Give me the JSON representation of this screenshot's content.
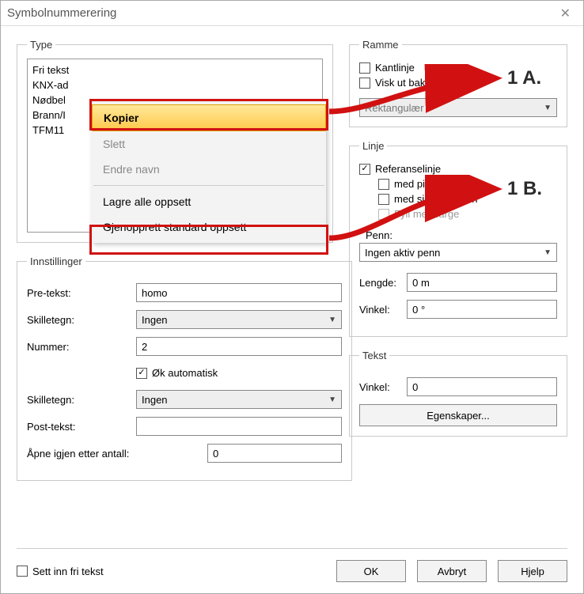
{
  "window": {
    "title": "Symbolnummerering"
  },
  "type": {
    "legend": "Type",
    "items": [
      "Fri tekst",
      "KNX-ad",
      "Nødbel",
      "Brann/I",
      "TFM11"
    ]
  },
  "context_menu": {
    "copy": "Kopier",
    "delete": "Slett",
    "rename": "Endre navn",
    "save_all": "Lagre alle oppsett",
    "restore_default": "Gjenopprett standard oppsett"
  },
  "settings": {
    "legend": "Innstillinger",
    "pretext_label": "Pre-tekst:",
    "pretext_value": "homo",
    "sep1_label": "Skilletegn:",
    "sep1_value": "Ingen",
    "number_label": "Nummer:",
    "number_value": "2",
    "auto_inc": "Øk automatisk",
    "sep2_label": "Skilletegn:",
    "sep2_value": "Ingen",
    "posttext_label": "Post-tekst:",
    "posttext_value": "",
    "reopen_label": "Åpne igjen etter antall:",
    "reopen_value": "0"
  },
  "frame": {
    "legend": "Ramme",
    "border": "Kantlinje",
    "erase_behind": "Visk ut bak rammen",
    "shape": "Rektangulær"
  },
  "line": {
    "legend": "Linje",
    "refline": "Referanselinje",
    "arrow_end": "med pil i enden",
    "circle_end": "med sirkel i enden",
    "fill_color": "Fyll med farge",
    "pen_label": "Penn:",
    "pen_value": "Ingen aktiv penn",
    "length_label": "Lengde:",
    "length_value": "0 m",
    "angle_label": "Vinkel:",
    "angle_value": "0 °"
  },
  "text": {
    "legend": "Tekst",
    "angle_label": "Vinkel:",
    "angle_value": "0",
    "properties_btn": "Egenskaper..."
  },
  "footer": {
    "free_text": "Sett inn fri tekst",
    "ok": "OK",
    "cancel": "Avbryt",
    "help": "Hjelp"
  },
  "annotations": {
    "a": "1 A.",
    "b": "1 B."
  }
}
